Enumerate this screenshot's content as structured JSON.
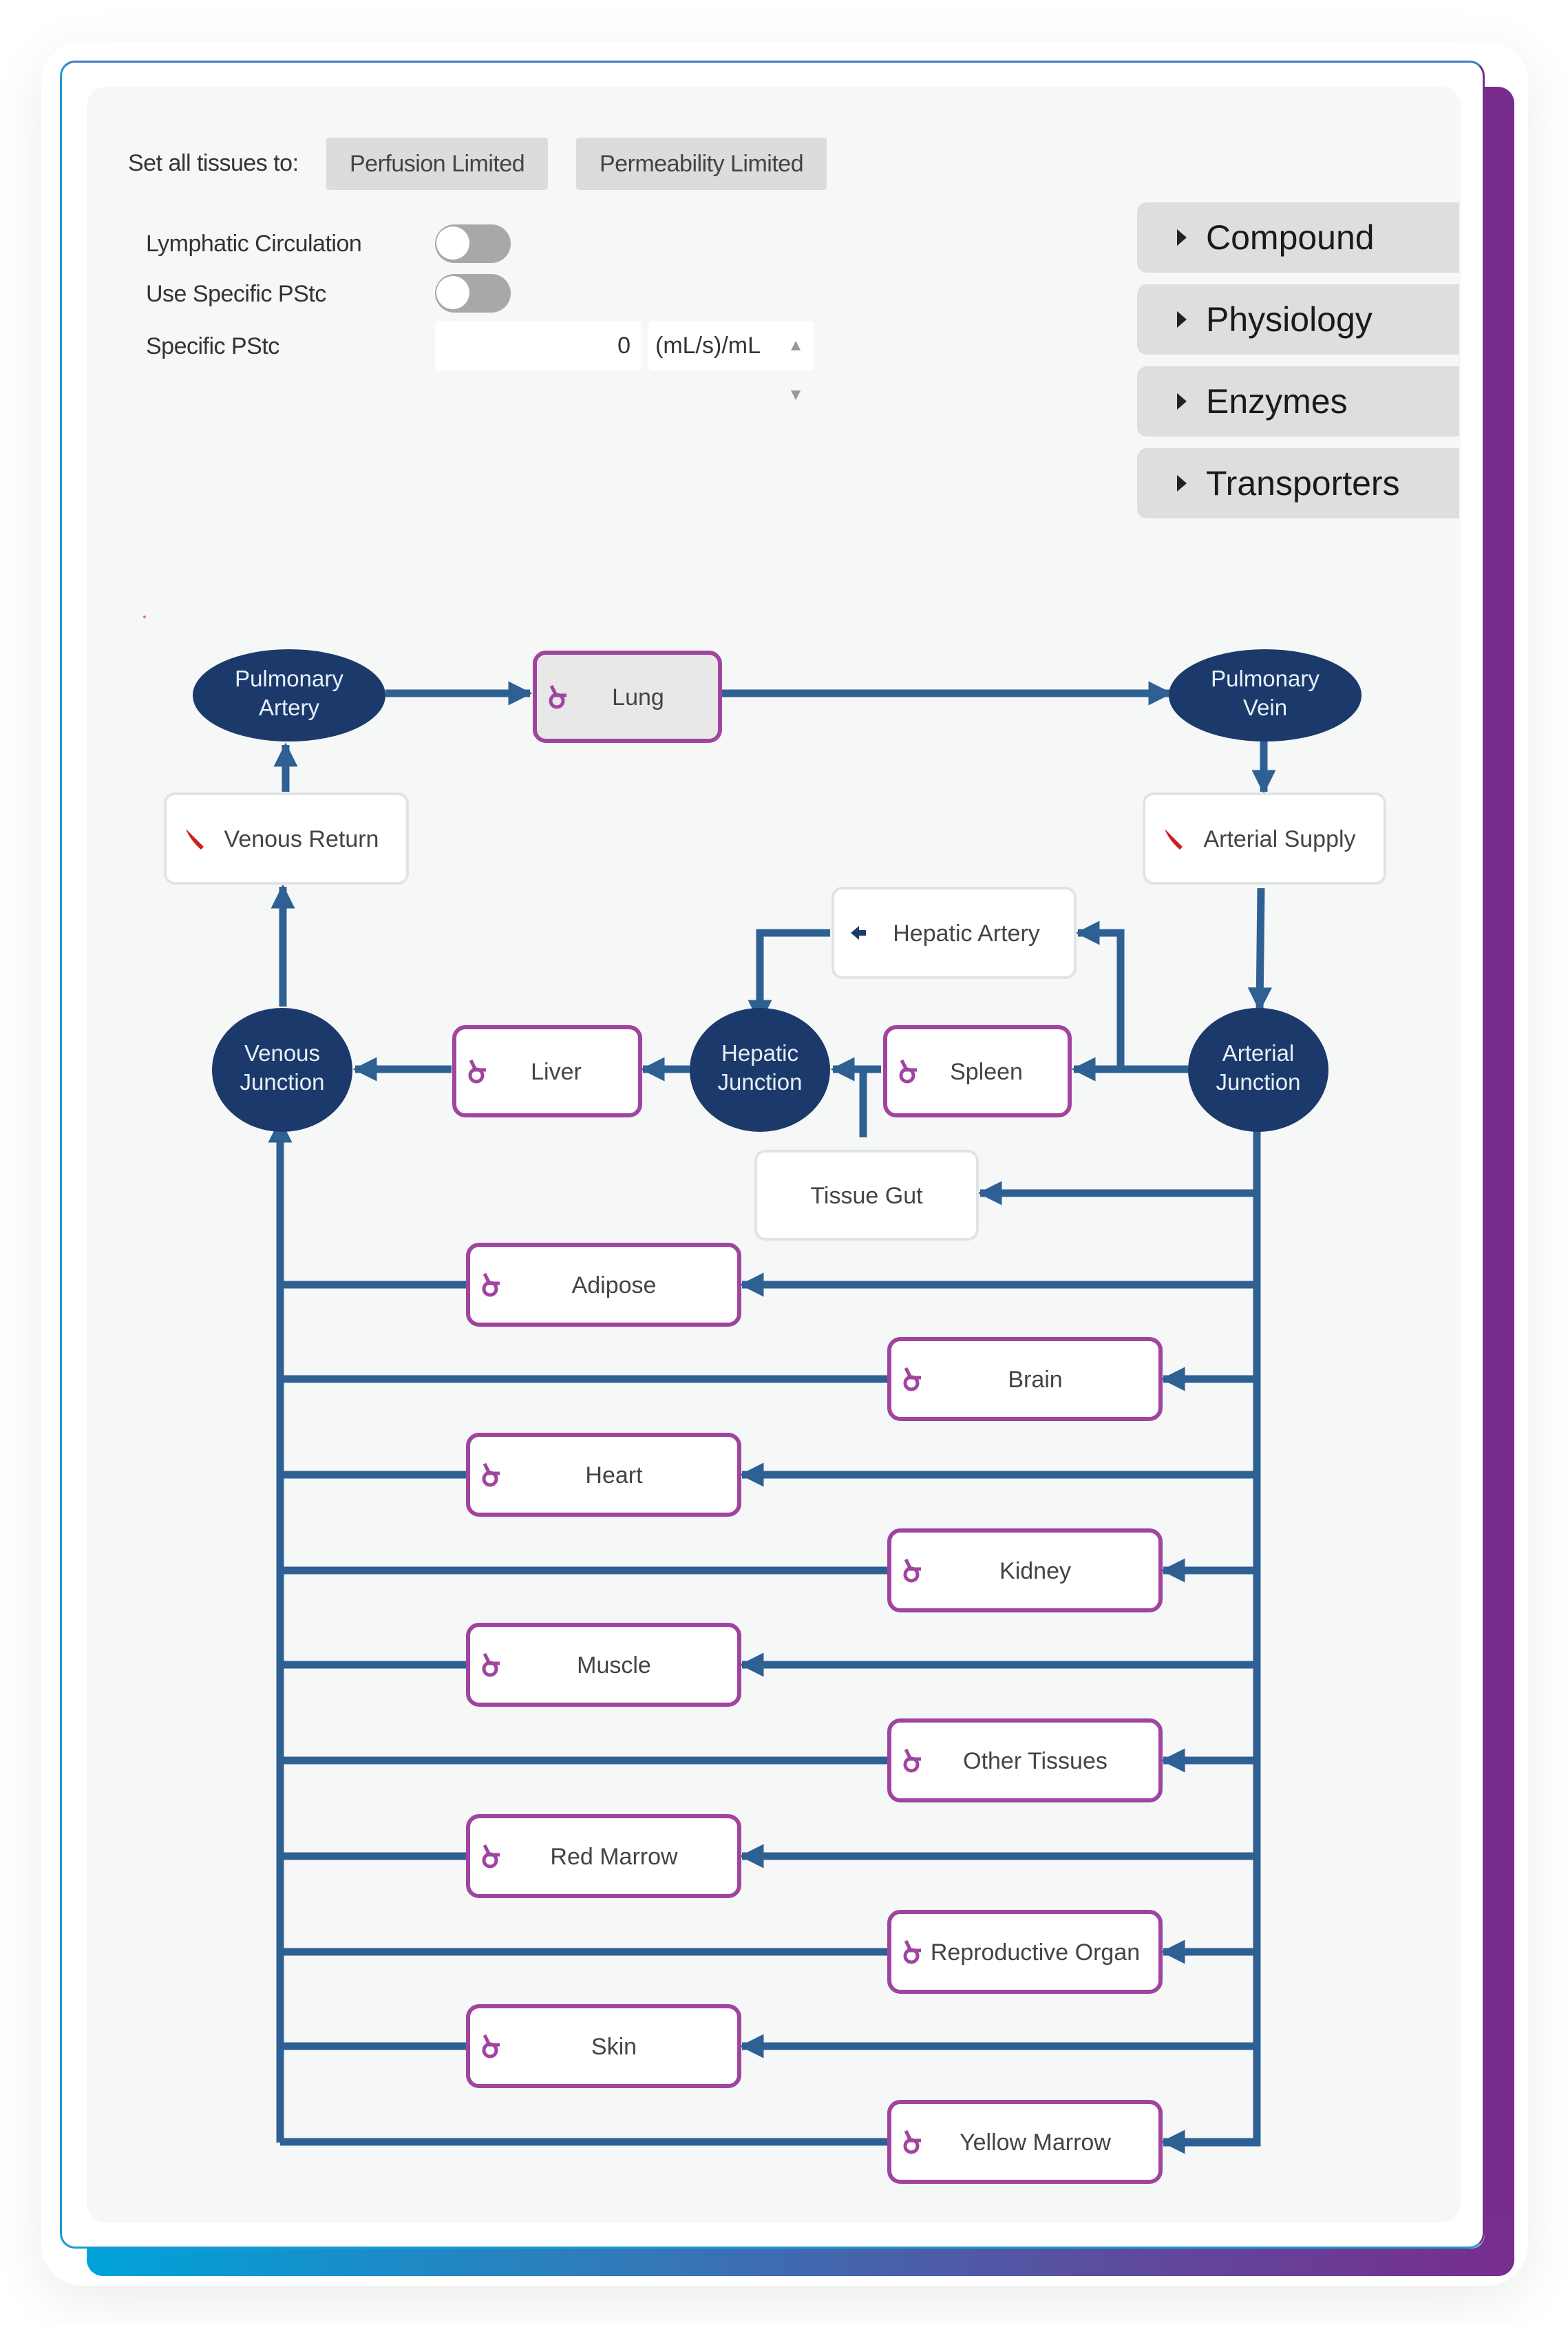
{
  "controls": {
    "set_all_label": "Set all tissues to:",
    "perfusion_button": "Perfusion Limited",
    "permeability_button": "Permeability Limited",
    "lymphatic_label": "Lymphatic Circulation",
    "lymphatic_on": false,
    "use_specific_label": "Use Specific PStc",
    "use_specific_on": false,
    "specific_pstc_label": "Specific PStc",
    "specific_pstc_value": "0",
    "specific_pstc_unit": "(mL/s)/mL"
  },
  "accordion": [
    {
      "label": "Compound",
      "icon": "caret-right-icon"
    },
    {
      "label": "Physiology",
      "icon": "caret-right-icon"
    },
    {
      "label": "Enzymes",
      "icon": "caret-right-icon"
    },
    {
      "label": "Transporters",
      "icon": "caret-right-icon"
    }
  ],
  "colors": {
    "junction_fill": "#1b3a6b",
    "edge": "#2e6094",
    "tissue_border": "#a0449f",
    "tissue_icon": "#a0449f",
    "blood_icon": "#cc1f1f",
    "accent_purple": "#782d8c",
    "accent_blue": "#00a3d9"
  },
  "diagram": {
    "junctions": {
      "pulmonary_artery": [
        "Pulmonary",
        "Artery"
      ],
      "pulmonary_vein": [
        "Pulmonary",
        "Vein"
      ],
      "venous_junction": [
        "Venous",
        "Junction"
      ],
      "hepatic_junction": [
        "Hepatic",
        "Junction"
      ],
      "arterial_junction": [
        "Arterial",
        "Junction"
      ]
    },
    "blood_nodes": {
      "venous_return": {
        "label": "Venous Return",
        "icon": "blood-vessel-icon"
      },
      "arterial_supply": {
        "label": "Arterial Supply",
        "icon": "blood-vessel-icon"
      },
      "hepatic_artery": {
        "label": "Hepatic Artery",
        "icon": "arrow-left-icon"
      },
      "tissue_gut": {
        "label": "Tissue Gut",
        "icon": ""
      }
    },
    "upper_tissues": {
      "lung": {
        "label": "Lung",
        "selected": true
      },
      "liver": {
        "label": "Liver",
        "selected": false
      },
      "spleen": {
        "label": "Spleen",
        "selected": false
      }
    },
    "tissues": [
      {
        "label": "Adipose",
        "side": "left"
      },
      {
        "label": "Brain",
        "side": "right"
      },
      {
        "label": "Heart",
        "side": "left"
      },
      {
        "label": "Kidney",
        "side": "right"
      },
      {
        "label": "Muscle",
        "side": "left"
      },
      {
        "label": "Other Tissues",
        "side": "right"
      },
      {
        "label": "Red Marrow",
        "side": "left"
      },
      {
        "label": "Reproductive Organ",
        "side": "right"
      },
      {
        "label": "Skin",
        "side": "left"
      },
      {
        "label": "Yellow Marrow",
        "side": "right"
      }
    ],
    "tissue_icon": "tissue-model-icon",
    "edges": [
      [
        "venous_return",
        "pulmonary_artery"
      ],
      [
        "pulmonary_artery",
        "lung"
      ],
      [
        "lung",
        "pulmonary_vein"
      ],
      [
        "pulmonary_vein",
        "arterial_supply"
      ],
      [
        "arterial_supply",
        "arterial_junction"
      ],
      [
        "arterial_junction",
        "spleen"
      ],
      [
        "arterial_junction",
        "hepatic_artery"
      ],
      [
        "arterial_junction",
        "tissue_gut"
      ],
      [
        "hepatic_artery",
        "hepatic_junction"
      ],
      [
        "spleen",
        "hepatic_junction"
      ],
      [
        "tissue_gut",
        "hepatic_junction"
      ],
      [
        "hepatic_junction",
        "liver"
      ],
      [
        "liver",
        "venous_junction"
      ],
      [
        "venous_junction",
        "venous_return"
      ],
      [
        "arterial_junction",
        "each tissue"
      ],
      [
        "each tissue",
        "venous_junction"
      ]
    ]
  }
}
